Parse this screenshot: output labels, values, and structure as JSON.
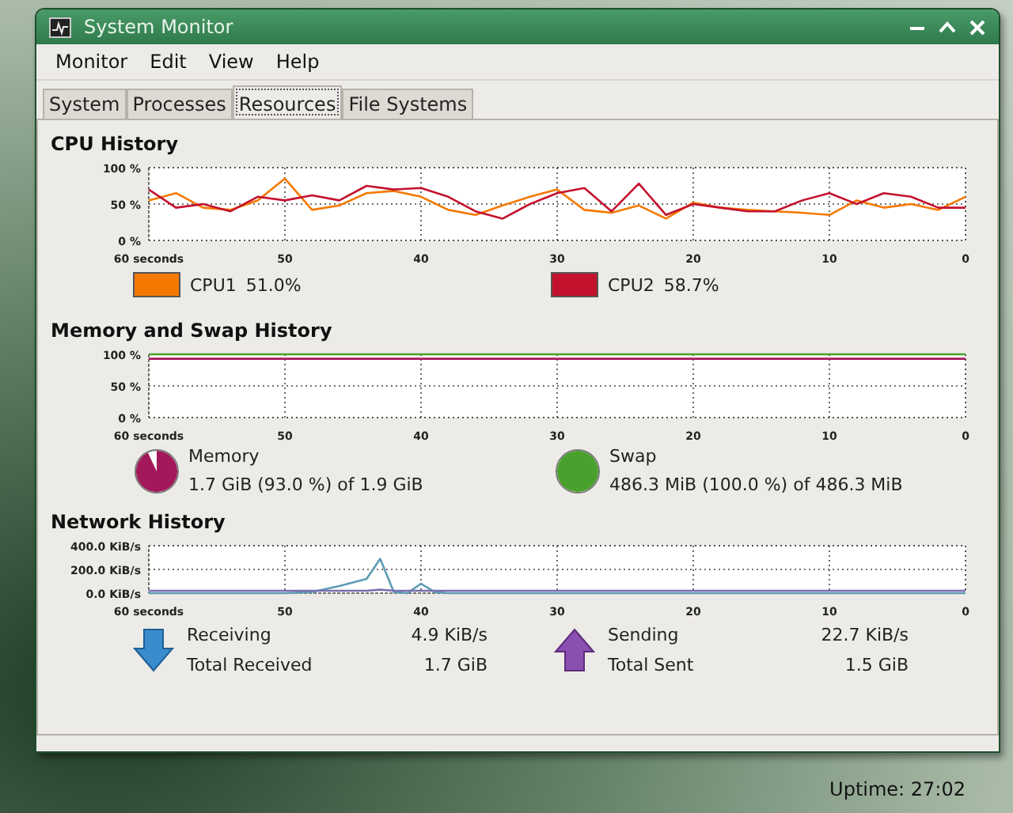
{
  "window": {
    "title": "System Monitor"
  },
  "menu": [
    {
      "label": "Monitor"
    },
    {
      "label": "Edit"
    },
    {
      "label": "View"
    },
    {
      "label": "Help"
    }
  ],
  "tabs": [
    {
      "label": "System",
      "selected": false
    },
    {
      "label": "Processes",
      "selected": false
    },
    {
      "label": "Resources",
      "selected": true
    },
    {
      "label": "File Systems",
      "selected": false
    }
  ],
  "cpu": {
    "heading": "CPU History",
    "chart_data": {
      "type": "line",
      "xlim": [
        60,
        0
      ],
      "ylim": [
        0,
        100
      ],
      "x": [
        60,
        58,
        56,
        54,
        52,
        50,
        48,
        46,
        44,
        42,
        40,
        38,
        36,
        34,
        32,
        30,
        28,
        26,
        24,
        22,
        20,
        18,
        16,
        14,
        12,
        10,
        8,
        6,
        4,
        2,
        0
      ],
      "grid": true,
      "series": [
        {
          "name": "CPU1",
          "color": "#f57900",
          "values": [
            55,
            65,
            45,
            42,
            55,
            85,
            42,
            48,
            65,
            68,
            60,
            42,
            35,
            48,
            60,
            70,
            42,
            38,
            48,
            30,
            52,
            45,
            42,
            40,
            38,
            35,
            55,
            45,
            50,
            42,
            60
          ]
        },
        {
          "name": "CPU2",
          "color": "#c4122e",
          "values": [
            70,
            45,
            50,
            40,
            60,
            55,
            62,
            55,
            75,
            70,
            72,
            60,
            40,
            30,
            50,
            65,
            72,
            40,
            78,
            35,
            50,
            45,
            40,
            40,
            55,
            65,
            50,
            65,
            60,
            45,
            45
          ]
        }
      ],
      "xticks": [
        {
          "value": 60,
          "label": "60 seconds"
        },
        50,
        40,
        30,
        20,
        10,
        0
      ],
      "yticks": [
        {
          "value": 0,
          "label": "0 %"
        },
        {
          "value": 50,
          "label": "50 %"
        },
        {
          "value": 100,
          "label": "100 %"
        }
      ]
    },
    "legend": [
      {
        "reading": "51.0%"
      },
      {
        "reading": "58.7%"
      }
    ]
  },
  "memory": {
    "heading": "Memory and Swap History",
    "chart_data": {
      "type": "line",
      "xlim": [
        60,
        0
      ],
      "ylim": [
        0,
        100
      ],
      "x": [
        60,
        0
      ],
      "grid": true,
      "series": [
        {
          "name": "Memory",
          "color": "#a3185a",
          "values": [
            93,
            93
          ]
        },
        {
          "name": "Swap",
          "color": "#4aa02c",
          "values": [
            100,
            100
          ]
        }
      ],
      "xticks": [
        {
          "value": 60,
          "label": "60 seconds"
        },
        50,
        40,
        30,
        20,
        10,
        0
      ],
      "yticks": [
        {
          "value": 0,
          "label": "0 %"
        },
        {
          "value": 50,
          "label": "50 %"
        },
        {
          "value": 100,
          "label": "100 %"
        }
      ]
    },
    "items": [
      {
        "detail": "1.7 GiB (93.0 %) of 1.9 GiB",
        "level": 0.93
      },
      {
        "detail": "486.3 MiB (100.0 %) of 486.3 MiB",
        "level": 1
      }
    ]
  },
  "network": {
    "heading": "Network History",
    "chart_data": {
      "type": "line",
      "xlim": [
        60,
        0
      ],
      "ylim": [
        0,
        400
      ],
      "x": [
        60,
        58,
        56,
        54,
        52,
        50,
        48,
        46,
        44,
        43,
        42,
        41,
        40,
        39,
        38,
        36,
        34,
        32,
        30,
        28,
        26,
        24,
        22,
        20,
        18,
        16,
        14,
        12,
        10,
        8,
        6,
        4,
        2,
        0
      ],
      "grid": true,
      "series": [
        {
          "name": "Receiving",
          "color": "#5f9bb5",
          "values": [
            0,
            0,
            0,
            0,
            0,
            0,
            10,
            60,
            120,
            290,
            10,
            0,
            80,
            10,
            0,
            0,
            0,
            0,
            0,
            0,
            0,
            0,
            0,
            0,
            0,
            0,
            0,
            0,
            0,
            0,
            0,
            0,
            0,
            0
          ]
        },
        {
          "name": "Sending",
          "color": "#7a6fb0",
          "values": [
            20,
            20,
            20,
            20,
            20,
            20,
            20,
            20,
            20,
            30,
            20,
            20,
            20,
            20,
            20,
            20,
            20,
            20,
            20,
            20,
            20,
            20,
            20,
            20,
            20,
            20,
            20,
            20,
            20,
            20,
            20,
            20,
            20,
            20
          ]
        }
      ],
      "xticks": [
        {
          "value": 60,
          "label": "60 seconds"
        },
        50,
        40,
        30,
        20,
        10,
        0
      ],
      "yticks": [
        {
          "value": 0,
          "label": "0.0 KiB/s"
        },
        {
          "value": 200,
          "label": "200.0 KiB/s"
        },
        {
          "value": 400,
          "label": "400.0 KiB/s"
        }
      ]
    },
    "stats": [
      {
        "kind": "receive",
        "value": "4.9 KiB/s",
        "total_label": "Total Received",
        "total": "1.7 GiB"
      },
      {
        "kind": "send",
        "value": "22.7 KiB/s",
        "total_label": "Total Sent",
        "total": "1.5 GiB"
      }
    ]
  },
  "desktop": {
    "uptime": "Uptime: 27:02"
  }
}
